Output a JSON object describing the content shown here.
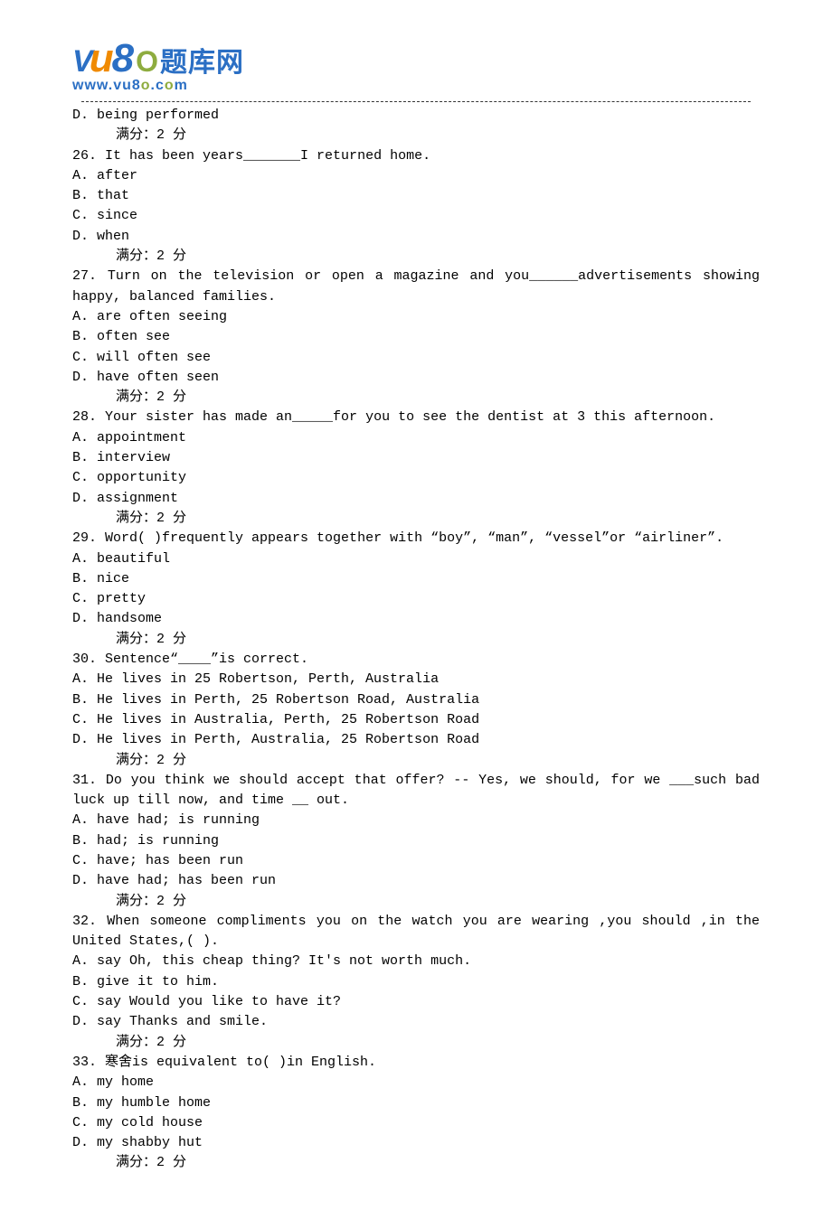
{
  "logo": {
    "v": "V",
    "u": "u",
    "eight": "8",
    "o": "O",
    "cn": "题库网",
    "url_prefix": "www.vu8",
    "url_o1": "o",
    "url_dot": ".c",
    "url_o2": "o",
    "url_suffix": "m"
  },
  "continued": {
    "option_d": "D. being performed",
    "score": "满分：2  分"
  },
  "questions": [
    {
      "num": "26.",
      "text": " It has been years_______I returned home.",
      "options": [
        "A. after",
        "B. that",
        "C. since",
        "D. when"
      ],
      "score": "满分：2  分"
    },
    {
      "num": "27.",
      "text": "  Turn on the television or open a magazine and you______advertisements showing happy, balanced families.",
      "options": [
        "A. are often seeing",
        "B. often see",
        "C. will often see",
        "D. have often seen"
      ],
      "score": "满分：2  分"
    },
    {
      "num": "28.",
      "text": " Your sister has made an_____for you to see the dentist at 3 this afternoon.",
      "options": [
        "A. appointment",
        "B. interview",
        "C. opportunity",
        "D. assignment"
      ],
      "score": "满分：2  分"
    },
    {
      "num": "29.",
      "text": " Word( )frequently appears together with “boy”, “man”, “vessel”or “airliner”.",
      "options": [
        "A. beautiful",
        "B. nice",
        "C. pretty",
        "D. handsome"
      ],
      "score": "满分：2  分"
    },
    {
      "num": "30.",
      "text": " Sentence“____”is correct.",
      "options": [
        "A. He lives in 25 Robertson, Perth, Australia",
        "B. He lives in Perth, 25 Robertson Road, Australia",
        "C. He lives in Australia, Perth, 25 Robertson Road",
        "D. He lives in Perth, Australia, 25 Robertson Road"
      ],
      "score": "满分：2  分"
    },
    {
      "num": "31.",
      "text": " Do you think we should accept that offer? -- Yes, we should, for we ___such bad luck up till now, and time __ out.",
      "options": [
        "A.  have had; is running",
        "B.  had; is running",
        "C. have; has been run",
        "D. have had; has been run"
      ],
      "score": "满分：2  分"
    },
    {
      "num": "32.",
      "text": "  When someone compliments you on the watch you are wearing ,you should ,in the United States,( ).",
      "options": [
        "A. say Oh, this cheap thing? It's not worth much.",
        "B. give it to him.",
        "C. say Would you like to have it?",
        "D. say Thanks and smile."
      ],
      "score": "满分：2  分"
    },
    {
      "num": "33.",
      "text": " 寒舍is equivalent to( )in English.",
      "options": [
        "A. my home",
        "B. my humble home",
        "C. my cold house",
        "D. my shabby hut"
      ],
      "score": "满分：2  分"
    }
  ]
}
